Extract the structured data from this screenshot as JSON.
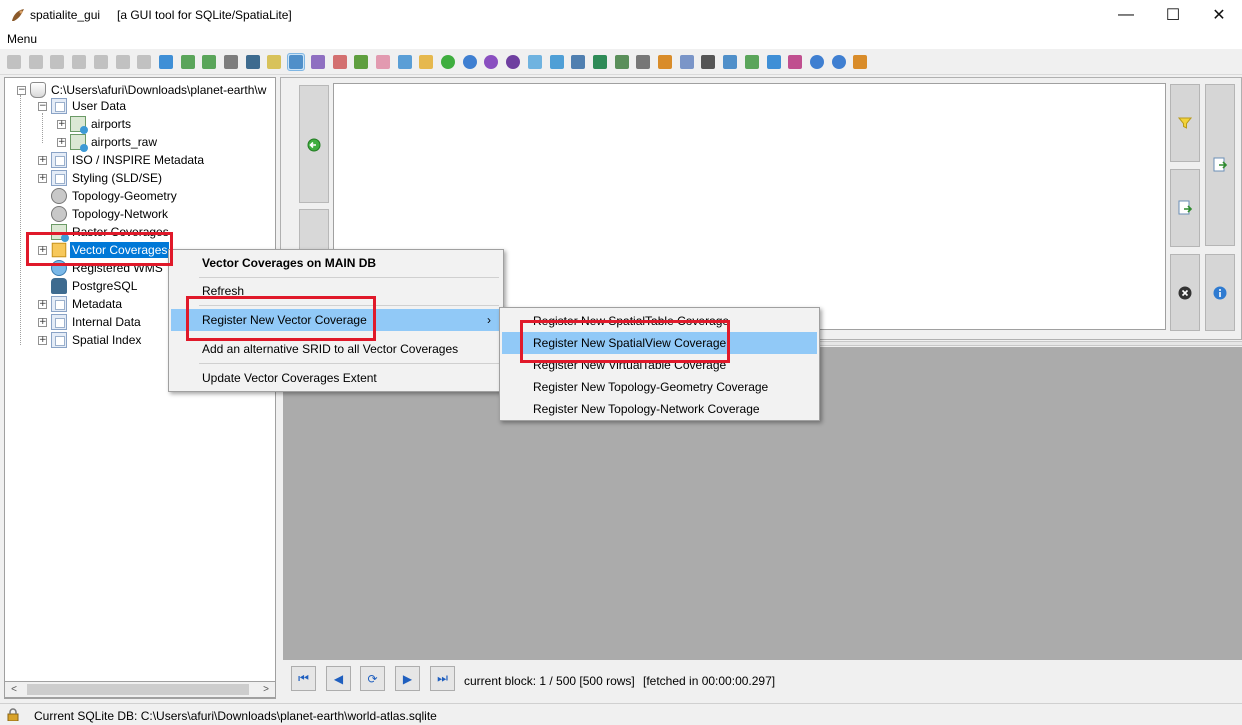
{
  "window": {
    "title": "spatialite_gui",
    "subtitle": "[a GUI tool for SQLite/SpatiaLite]",
    "minimize_glyph": "—",
    "maximize_glyph": "☐",
    "close_glyph": "✕"
  },
  "menubar": {
    "menu_label": "Menu"
  },
  "toolbar": {
    "icons": [
      "connect-icon",
      "disconnect-icon",
      "memory-db-icon",
      "new-db-icon",
      "save-db-icon",
      "clone-db-icon",
      "vacuum-icon",
      "sql-icon",
      "load-shp-icon",
      "virtual-shp-icon",
      "network-icon",
      "postgres-icon",
      "map-icon",
      "layout-icon",
      "srid-icon",
      "chart-icon",
      "bug-icon",
      "eraser-icon",
      "export-icon",
      "import-icon",
      "globe-green-icon",
      "globe-blue-icon",
      "globe-purple-icon",
      "globe-dark-icon",
      "page-export-icon",
      "page-import-icon",
      "table-icon",
      "excel-icon",
      "calc-icon",
      "eye-icon",
      "palette-icon",
      "copy-icon",
      "text-icon",
      "wifi-icon",
      "sync-icon",
      "image-icon",
      "pdf-icon",
      "help-icon",
      "info-icon",
      "exit-icon"
    ]
  },
  "tree": {
    "root": "C:\\Users\\afuri\\Downloads\\planet-earth\\w",
    "user_data": "User Data",
    "airports": "airports",
    "airports_raw": "airports_raw",
    "iso_metadata": "ISO / INSPIRE Metadata",
    "styling": "Styling (SLD/SE)",
    "topo_geometry": "Topology-Geometry",
    "topo_network": "Topology-Network",
    "raster_coverages": "Raster Coverages",
    "vector_coverages": "Vector Coverages",
    "registered_wms": "Registered WMS",
    "postgresql": "PostgreSQL",
    "metadata": "Metadata",
    "internal_data": "Internal Data",
    "spatial_index": "Spatial Index"
  },
  "context_menu": {
    "header": "Vector Coverages on MAIN DB",
    "refresh": "Refresh",
    "register_new": "Register New Vector Coverage",
    "add_srid": "Add an alternative SRID to all Vector Coverages",
    "update_extent": "Update Vector Coverages Extent",
    "submenu_arrow": "›"
  },
  "submenu": {
    "spatial_table": "Register New SpatialTable Coverage",
    "spatial_view": "Register New SpatialView Coverage",
    "virtual_table": "Register New VirtualTable Coverage",
    "topo_geometry": "Register New Topology-Geometry Coverage",
    "topo_network": "Register New Topology-Network Coverage"
  },
  "results": {
    "block_info": "current block: 1 / 500 [500 rows]",
    "fetch_info": "[fetched in 00:00:00.297]"
  },
  "status": {
    "text": "Current SQLite DB: C:\\Users\\afuri\\Downloads\\planet-earth\\world-atlas.sqlite"
  },
  "colors": {
    "selection": "#0078d7",
    "menu_highlight": "#91c9f7",
    "annotation_red": "#e0192a"
  }
}
